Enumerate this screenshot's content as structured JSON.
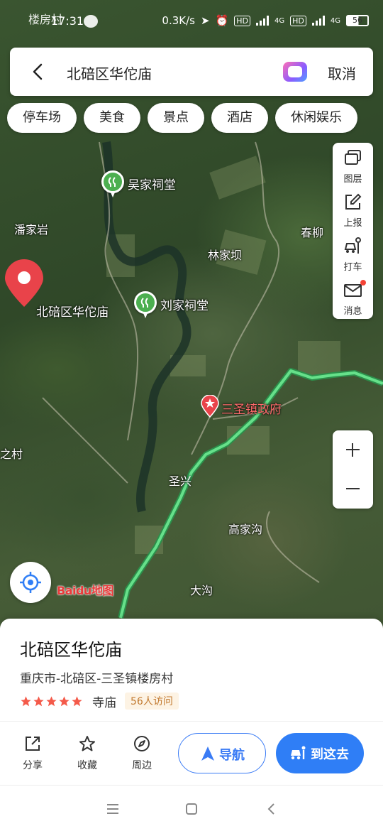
{
  "status_bar": {
    "village": "楼房村",
    "time": "17:31",
    "network_speed": "0.3K/s",
    "signal_label_1": "4G",
    "signal_label_2": "4G",
    "hd_label": "HD",
    "battery": "56"
  },
  "search": {
    "query": "北碚区华佗庙",
    "cancel_label": "取消"
  },
  "categories": [
    "停车场",
    "美食",
    "景点",
    "酒店",
    "休闲娱乐"
  ],
  "tools": {
    "layers_label": "图层",
    "report_label": "上报",
    "taxi_label": "打车",
    "messages_label": "消息"
  },
  "map": {
    "labels": {
      "wu_temple": "吴家祠堂",
      "liu_temple": "刘家祠堂",
      "panjiayan": "潘家岩",
      "linjiaba": "林家坝",
      "chunliu": "春柳",
      "target": "北碚区华佗庙",
      "town_gov": "三圣镇政府",
      "sansheng": "圣兴",
      "gaojiagou": "高家沟",
      "dagou": "大沟",
      "village_left": "之村"
    },
    "colors": {
      "route": "#66e08a",
      "marker": "#e9434a",
      "poi": "#4caf50"
    }
  },
  "logo": "Baidu地图",
  "place": {
    "name": "北碚区华佗庙",
    "address": "重庆市-北碚区-三圣镇楼房村",
    "rating": 5,
    "category": "寺庙",
    "visits": "56人访问"
  },
  "actions": {
    "share": "分享",
    "favorite": "收藏",
    "nearby": "周边",
    "navigate": "导航",
    "go_here": "到这去"
  }
}
